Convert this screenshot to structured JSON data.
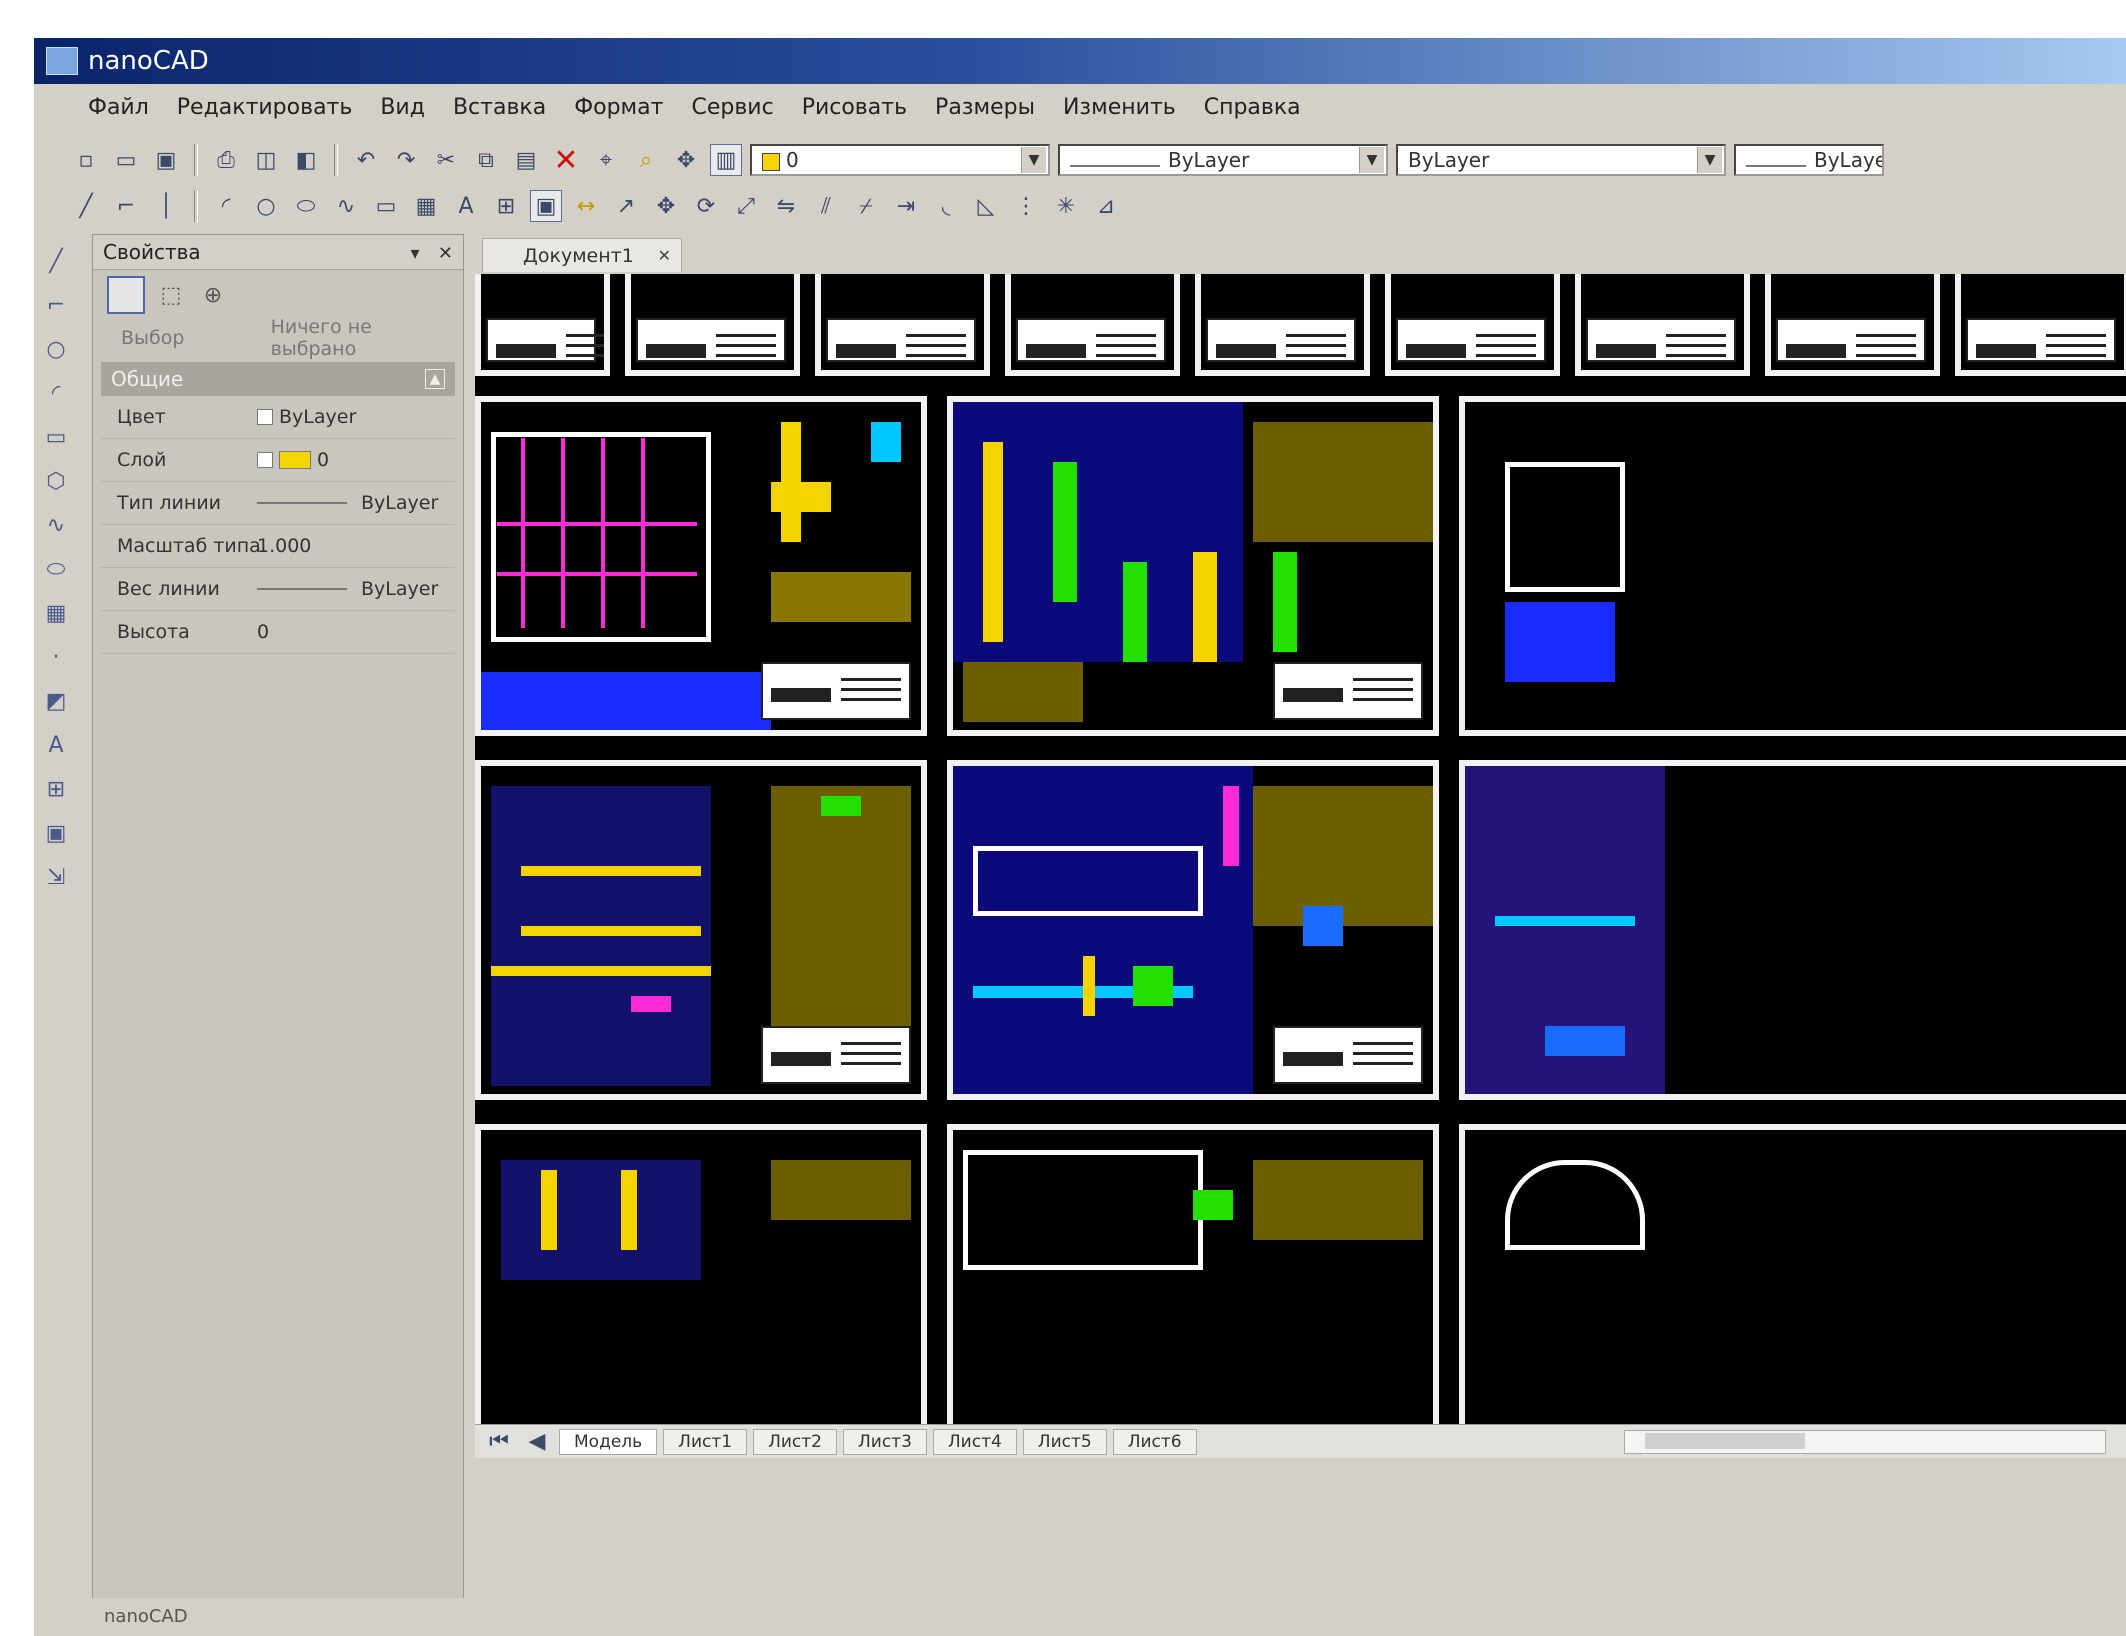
{
  "window": {
    "title": "nanoCAD"
  },
  "menu": [
    "Файл",
    "Редактировать",
    "Вид",
    "Вставка",
    "Формат",
    "Сервис",
    "Рисовать",
    "Размеры",
    "Изменить",
    "Справка"
  ],
  "toolbar": {
    "layer_combo": "0",
    "linetype_combo": "ByLayer",
    "lineweight_combo": "ByLayer",
    "color_combo": "ByLayer"
  },
  "properties_panel": {
    "title": "Свойства",
    "selection_label": "Выбор",
    "selection_value": "Ничего не выбрано",
    "section_title": "Общие",
    "rows": [
      {
        "label": "Цвет",
        "value": "ByLayer"
      },
      {
        "label": "Слой",
        "value": "0"
      },
      {
        "label": "Тип линии",
        "value": "ByLayer"
      },
      {
        "label": "Масштаб типа",
        "value": "1.000"
      },
      {
        "label": "Вес линии",
        "value": "ByLayer"
      },
      {
        "label": "Высота",
        "value": "0"
      }
    ]
  },
  "document_tab": {
    "label": "Документ1"
  },
  "layout_tabs": [
    "Модель",
    "Лист1",
    "Лист2",
    "Лист3",
    "Лист4",
    "Лист5",
    "Лист6"
  ],
  "status": {
    "text": "nanoCAD"
  },
  "colors": {
    "titlebar_start": "#0a246a",
    "canvas_bg": "#000000",
    "sheet_border": "#f2f2f2",
    "cad_yellow": "#f5d300",
    "cad_blue": "#1a2cff",
    "cad_green": "#22e000",
    "cad_magenta": "#ff2bd6",
    "cad_cyan": "#00c8ff"
  }
}
